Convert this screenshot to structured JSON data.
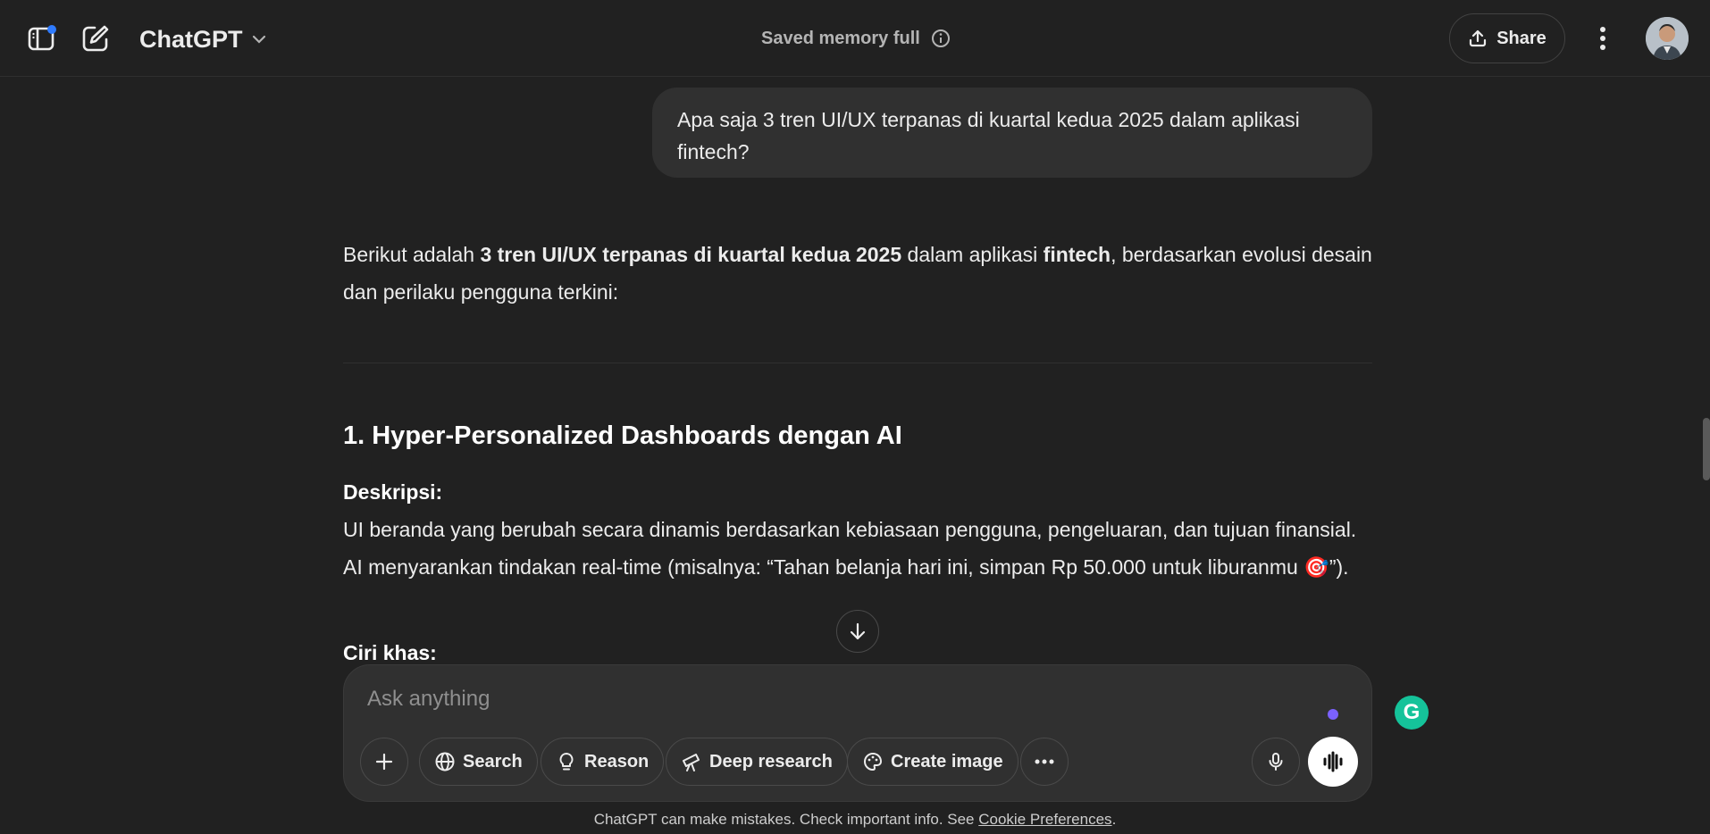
{
  "header": {
    "app_title": "ChatGPT",
    "memory_status": "Saved memory full",
    "share_label": "Share"
  },
  "conversation": {
    "user_message": "Apa saja 3 tren UI/UX terpanas di kuartal kedua 2025 dalam aplikasi fintech?",
    "intro": {
      "part1": "Berikut adalah ",
      "bold1": "3 tren UI/UX terpanas di kuartal kedua 2025",
      "part2": " dalam aplikasi ",
      "bold2": "fintech",
      "part3": ", berdasarkan evolusi desain dan perilaku pengguna terkini:"
    },
    "section1": {
      "heading": "1. Hyper-Personalized Dashboards dengan AI",
      "desc_label": "Deskripsi:",
      "desc_text": "UI beranda yang berubah secara dinamis berdasarkan kebiasaan pengguna, pengeluaran, dan tujuan finansial. AI menyarankan tindakan real-time (misalnya: “Tahan belanja hari ini, simpan Rp 50.000 untuk liburanmu 🎯”).",
      "traits_label": "Ciri khas:"
    }
  },
  "composer": {
    "placeholder": "Ask anything",
    "tools": {
      "search": "Search",
      "reason": "Reason",
      "deep_research": "Deep research",
      "create_image": "Create image"
    }
  },
  "footer": {
    "text": "ChatGPT can make mistakes. Check important info. See ",
    "link": "Cookie Preferences",
    "end": "."
  },
  "colors": {
    "background": "#212121",
    "bubble": "#303030",
    "accent_dot": "#7b61ff",
    "sidebar_badge": "#2f7bff",
    "grammarly": "#15c39a"
  }
}
